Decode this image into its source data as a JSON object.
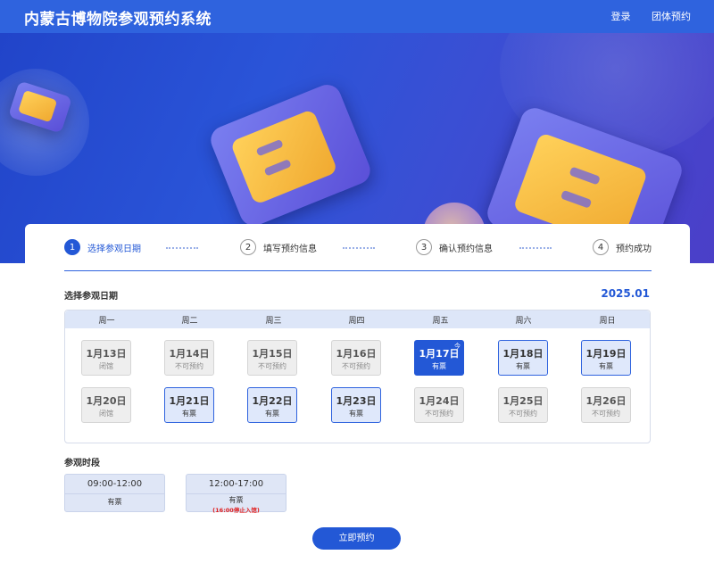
{
  "header": {
    "title": "内蒙古博物院参观预约系统",
    "nav": {
      "login": "登录",
      "group": "团体预约"
    }
  },
  "steps": [
    {
      "num": "1",
      "label": "选择参观日期"
    },
    {
      "num": "2",
      "label": "填写预约信息"
    },
    {
      "num": "3",
      "label": "确认预约信息"
    },
    {
      "num": "4",
      "label": "预约成功"
    }
  ],
  "date_section": {
    "title": "选择参观日期",
    "year_month": "2025.01"
  },
  "weekdays": [
    "周一",
    "周二",
    "周三",
    "周四",
    "周五",
    "周六",
    "周日"
  ],
  "days": [
    {
      "date": "1月13日",
      "status": "闭馆"
    },
    {
      "date": "1月14日",
      "status": "不可预约"
    },
    {
      "date": "1月15日",
      "status": "不可预约"
    },
    {
      "date": "1月16日",
      "status": "不可预约"
    },
    {
      "date": "1月17日",
      "status": "有票",
      "today": "今"
    },
    {
      "date": "1月18日",
      "status": "有票"
    },
    {
      "date": "1月19日",
      "status": "有票"
    },
    {
      "date": "1月20日",
      "status": "闭馆"
    },
    {
      "date": "1月21日",
      "status": "有票"
    },
    {
      "date": "1月22日",
      "status": "有票"
    },
    {
      "date": "1月23日",
      "status": "有票"
    },
    {
      "date": "1月24日",
      "status": "不可预约"
    },
    {
      "date": "1月25日",
      "status": "不可预约"
    },
    {
      "date": "1月26日",
      "status": "不可预约"
    }
  ],
  "time_section": {
    "title": "参观时段"
  },
  "slots": [
    {
      "time": "09:00-12:00",
      "status": "有票",
      "note": ""
    },
    {
      "time": "12:00-17:00",
      "status": "有票",
      "note": "(16:00停止入馆)"
    }
  ],
  "submit_label": "立即预约",
  "colors": {
    "primary": "#2358d6",
    "header": "#2f63de",
    "alert": "#e02020"
  }
}
